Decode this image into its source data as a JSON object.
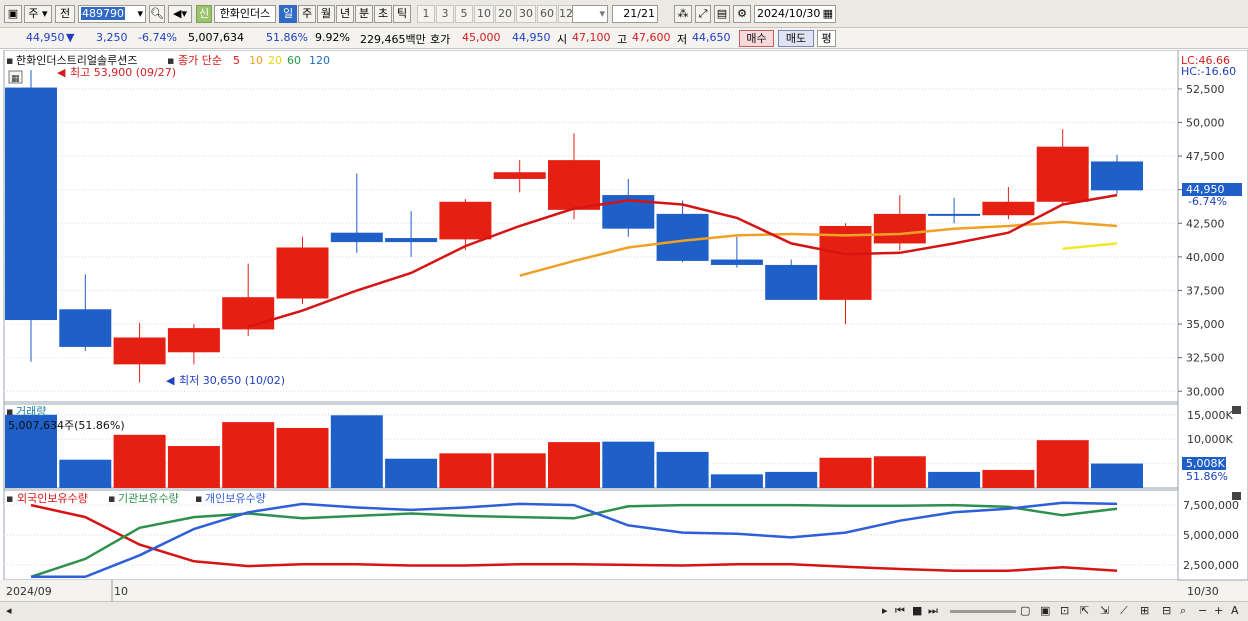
{
  "toolbar": {
    "market": "주",
    "prev_label": "전",
    "code": "489790",
    "name": "한화인더스",
    "new_badge": "신",
    "periods": [
      {
        "label": "일",
        "selected": true
      },
      {
        "label": "주",
        "selected": false
      },
      {
        "label": "월",
        "selected": false
      },
      {
        "label": "년",
        "selected": false
      },
      {
        "label": "분",
        "selected": false
      },
      {
        "label": "초",
        "selected": false
      },
      {
        "label": "틱",
        "selected": false
      }
    ],
    "minutes": [
      "1",
      "3",
      "5",
      "10",
      "20",
      "30",
      "60",
      "120"
    ],
    "count": "21",
    "count_total": "/21",
    "date": "2024/10/30"
  },
  "quote": {
    "price": "44,950",
    "change_arrow": "▼",
    "change": "3,250",
    "change_pct": "-6.74%",
    "volume": "5,007,634",
    "vol_ratio": "51.86%",
    "turnover_rate": "9.92%",
    "value": "229,465백만",
    "hoga_label": "호가",
    "ask": "45,000",
    "bid": "44,950",
    "open_label": "시",
    "open": "47,100",
    "high_label": "고",
    "high": "47,600",
    "low_label": "저",
    "low": "44,650",
    "buy": "매수",
    "sell": "매도",
    "flat": "평"
  },
  "price_panel": {
    "title": "한화인더스트리얼솔루션즈",
    "ma_label": "종가 단순",
    "ma_periods": [
      "5",
      "10",
      "20",
      "60",
      "120"
    ],
    "lc": "LC:46.66",
    "hc": "HC:-16.60",
    "high_marker": "최고 53,900 (09/27)",
    "low_marker": "최저 30,650 (10/02)",
    "current_tag": "44,950",
    "current_pct": "-6.74%"
  },
  "volume_panel": {
    "title": "거래량",
    "last_label": "5,007,634주(51.86%)",
    "tag": "5,008K",
    "tag_pct": "51.86%"
  },
  "holdings_panel": {
    "legend": [
      "외국인보유수량",
      "기관보유수량",
      "개인보유수량"
    ]
  },
  "date_axis": {
    "start": "2024/09",
    "mid": "10",
    "end": "10/30"
  },
  "colors": {
    "up": "#e52012",
    "down": "#1e5fc8",
    "ma5": "#d61414",
    "ma10": "#f0a024",
    "ma20": "#f2e82a",
    "ma60": "#1e9e46",
    "ma120": "#1e6fb8",
    "foreign": "#d61414",
    "inst": "#2f8f4e",
    "indiv": "#2f5fd8"
  },
  "chart_data": {
    "type": "candlestick",
    "price_axis": {
      "ticks": [
        30000,
        32500,
        35000,
        37500,
        40000,
        42500,
        45000,
        47500,
        50000,
        52500
      ],
      "range": [
        29200,
        54800
      ]
    },
    "volume_axis": {
      "ticks": [
        "5,000K",
        "10,000K",
        "15,000K"
      ],
      "tick_values": [
        5000,
        10000,
        15000
      ],
      "range": [
        0,
        16800
      ]
    },
    "holdings_axis": {
      "ticks": [
        "2,500,000",
        "5,000,000",
        "7,500,000"
      ],
      "tick_values": [
        2500000,
        5000000,
        7500000
      ],
      "range": [
        1400000,
        8600000
      ]
    },
    "candles": [
      {
        "o": 52600,
        "h": 53900,
        "l": 32200,
        "c": 35300,
        "v": 15000
      },
      {
        "o": 36100,
        "h": 38700,
        "l": 33000,
        "c": 33300,
        "v": 5800
      },
      {
        "o": 32000,
        "h": 35100,
        "l": 30650,
        "c": 34000,
        "v": 10900
      },
      {
        "o": 32900,
        "h": 35000,
        "l": 32000,
        "c": 34700,
        "v": 8600
      },
      {
        "o": 34600,
        "h": 39500,
        "l": 34100,
        "c": 37000,
        "v": 13500
      },
      {
        "o": 36900,
        "h": 41500,
        "l": 36500,
        "c": 40700,
        "v": 12300
      },
      {
        "o": 41800,
        "h": 46200,
        "l": 40300,
        "c": 41100,
        "v": 14900
      },
      {
        "o": 41400,
        "h": 43400,
        "l": 40000,
        "c": 41100,
        "v": 6000
      },
      {
        "o": 41300,
        "h": 44300,
        "l": 40500,
        "c": 44100,
        "v": 7100
      },
      {
        "o": 45800,
        "h": 47200,
        "l": 44800,
        "c": 46300,
        "v": 7100
      },
      {
        "o": 43500,
        "h": 49200,
        "l": 42800,
        "c": 47200,
        "v": 9400
      },
      {
        "o": 44600,
        "h": 45800,
        "l": 41500,
        "c": 42100,
        "v": 9500
      },
      {
        "o": 43200,
        "h": 44200,
        "l": 39600,
        "c": 39700,
        "v": 7400
      },
      {
        "o": 39800,
        "h": 41500,
        "l": 39200,
        "c": 39400,
        "v": 2800
      },
      {
        "o": 39400,
        "h": 39800,
        "l": 36800,
        "c": 36800,
        "v": 3300
      },
      {
        "o": 36800,
        "h": 42500,
        "l": 35000,
        "c": 42300,
        "v": 6200
      },
      {
        "o": 41000,
        "h": 44600,
        "l": 40500,
        "c": 43200,
        "v": 6500
      },
      {
        "o": 43200,
        "h": 44400,
        "l": 42500,
        "c": 43100,
        "v": 3300
      },
      {
        "o": 43100,
        "h": 45200,
        "l": 42800,
        "c": 44100,
        "v": 3700
      },
      {
        "o": 44100,
        "h": 49500,
        "l": 43900,
        "c": 48200,
        "v": 9800
      },
      {
        "o": 47100,
        "h": 47600,
        "l": 44650,
        "c": 44950,
        "v": 5008
      }
    ],
    "ma5": [
      null,
      null,
      null,
      null,
      34800,
      36000,
      37500,
      38800,
      40800,
      42300,
      43600,
      44200,
      43900,
      42900,
      41000,
      40200,
      40300,
      41000,
      41800,
      43900,
      44600
    ],
    "ma10": [
      null,
      null,
      null,
      null,
      null,
      null,
      null,
      null,
      null,
      38600,
      39700,
      40700,
      41200,
      41600,
      41700,
      41600,
      41700,
      42100,
      42300,
      42600,
      42300
    ],
    "ma20": [
      null,
      null,
      null,
      null,
      null,
      null,
      null,
      null,
      null,
      null,
      null,
      null,
      null,
      null,
      null,
      null,
      null,
      null,
      null,
      40600,
      41000
    ],
    "foreign_holdings": [
      7500000,
      6500000,
      4200000,
      2800000,
      2400000,
      2550000,
      2550000,
      2450000,
      2450000,
      2550000,
      2550000,
      2500000,
      2450000,
      2550000,
      2550000,
      2350000,
      2150000,
      2000000,
      2000000,
      2300000,
      2000000
    ],
    "inst_holdings": [
      1500000,
      3000000,
      5600000,
      6500000,
      6800000,
      6400000,
      6600000,
      6800000,
      6600000,
      6500000,
      6400000,
      7400000,
      7500000,
      7500000,
      7500000,
      7450000,
      7450000,
      7500000,
      7350000,
      6650000,
      7200000
    ],
    "indiv_holdings": [
      1500000,
      1500000,
      3300000,
      5500000,
      6900000,
      7600000,
      7300000,
      7100000,
      7300000,
      7600000,
      7500000,
      5800000,
      5200000,
      5100000,
      4800000,
      5200000,
      6200000,
      6900000,
      7200000,
      7700000,
      7600000
    ]
  }
}
